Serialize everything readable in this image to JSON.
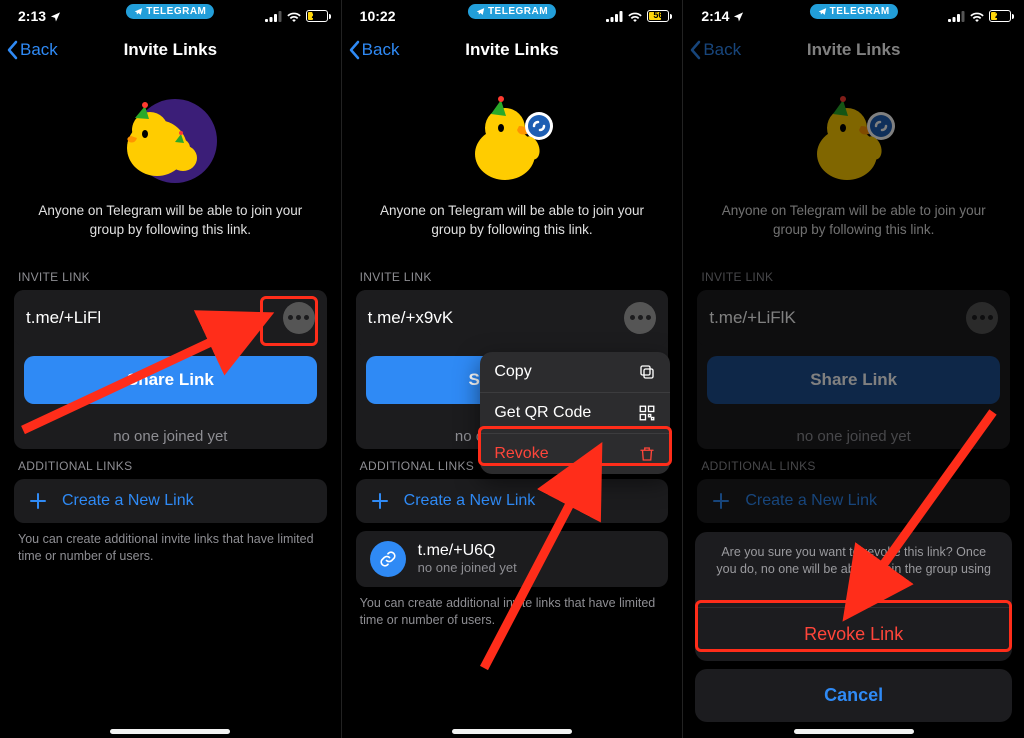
{
  "pill_label": "TELEGRAM",
  "nav_title": "Invite Links",
  "back_label": "Back",
  "caption": "Anyone on Telegram will be able to join your group by following this link.",
  "section_invite": "INVITE LINK",
  "section_additional": "ADDITIONAL LINKS",
  "share_label": "Share Link",
  "status_none": "no one joined yet",
  "create_label": "Create a New Link",
  "footer_note": "You can create additional invite links that have limited time or number of users.",
  "screen1": {
    "time": "2:13",
    "battery": "26",
    "link": "t.me/+LiFl"
  },
  "screen2": {
    "time": "10:22",
    "battery": "56",
    "link": "t.me/+x9vK",
    "extra_link": "t.me/+U6Q",
    "extra_status": "no one joined yet",
    "menu": {
      "copy": "Copy",
      "qr": "Get QR Code",
      "revoke": "Revoke"
    }
  },
  "screen3": {
    "time": "2:14",
    "battery": "26",
    "link": "t.me/+LiFlK",
    "sheet_msg": "Are you sure you want to revoke this link? Once you do, no one will be able to join the group using it.",
    "revoke_btn": "Revoke Link",
    "cancel_btn": "Cancel"
  }
}
